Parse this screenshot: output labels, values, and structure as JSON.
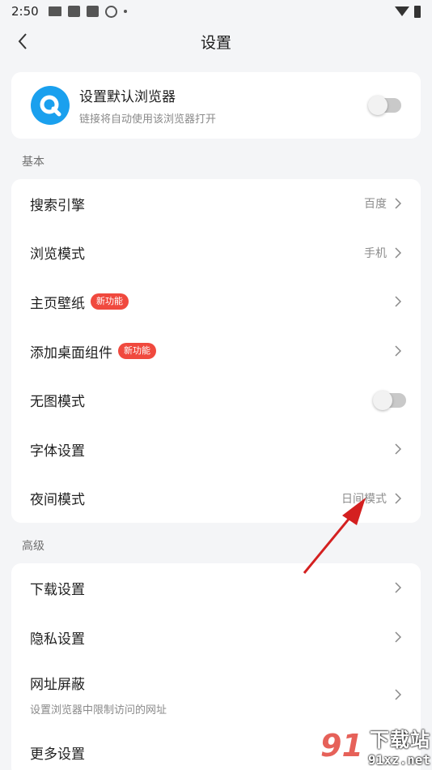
{
  "status_bar": {
    "time": "2:50"
  },
  "header": {
    "title": "设置"
  },
  "default_browser": {
    "title": "设置默认浏览器",
    "subtitle": "链接将自动使用该浏览器打开",
    "toggle_on": false
  },
  "basic": {
    "label": "基本",
    "items": [
      {
        "label": "搜索引擎",
        "value": "百度"
      },
      {
        "label": "浏览模式",
        "value": "手机"
      },
      {
        "label": "主页壁纸",
        "badge": "新功能"
      },
      {
        "label": "添加桌面组件",
        "badge": "新功能"
      },
      {
        "label": "无图模式",
        "toggle_on": false
      },
      {
        "label": "字体设置"
      },
      {
        "label": "夜间模式",
        "value": "日间模式"
      }
    ]
  },
  "advanced": {
    "label": "高级",
    "items": [
      {
        "label": "下载设置"
      },
      {
        "label": "隐私设置"
      },
      {
        "label": "网址屏蔽",
        "subtitle": "设置浏览器中限制访问的网址"
      },
      {
        "label": "更多设置"
      }
    ]
  },
  "watermark": {
    "logo": "91",
    "title": "下载站",
    "url": "91xz.net"
  },
  "colors": {
    "accent_blue": "#1aa0ee",
    "badge_red": "#f0493e",
    "annotation_arrow": "#d42020"
  }
}
